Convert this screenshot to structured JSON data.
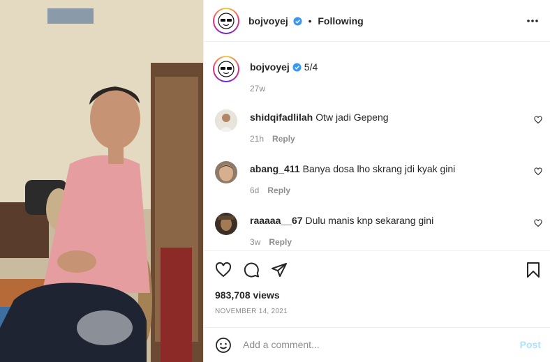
{
  "header": {
    "username": "bojvoyej",
    "separator": "•",
    "follow_label": "Following",
    "more_icon": "more-horizontal-icon"
  },
  "caption": {
    "username": "bojvoyej",
    "text": "5/4",
    "time": "27w"
  },
  "comments": [
    {
      "username": "shidqifadlilah",
      "text": "Otw jadi Gepeng",
      "time": "21h",
      "reply_label": "Reply"
    },
    {
      "username": "abang_411",
      "text": "Banya dosa lho skrang jdi kyak gini",
      "time": "6d",
      "reply_label": "Reply"
    },
    {
      "username": "raaaaa__67",
      "text": "Dulu manis knp sekarang gini",
      "time": "3w",
      "reply_label": "Reply"
    }
  ],
  "actions": {
    "views": "983,708 views",
    "date": "NOVEMBER 14, 2021"
  },
  "add_comment": {
    "placeholder": "Add a comment...",
    "post_label": "Post"
  },
  "colors": {
    "verified": "#3897f0",
    "post_disabled": "#b2dffc",
    "secondary_text": "#8e8e8e"
  }
}
